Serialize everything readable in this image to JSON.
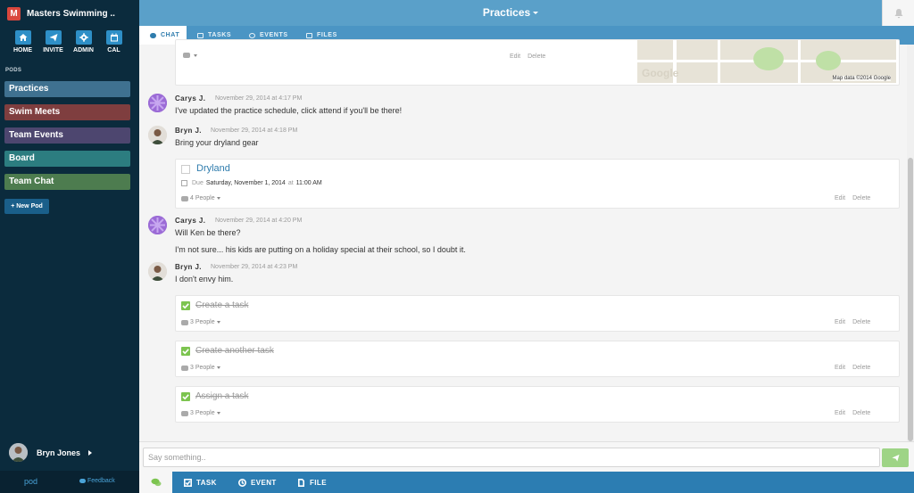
{
  "sidebar": {
    "team_initial": "M",
    "team_name": "Masters Swimming ..",
    "nav": [
      {
        "label": "HOME",
        "icon": "home-icon"
      },
      {
        "label": "INVITE",
        "icon": "paper-plane-icon"
      },
      {
        "label": "ADMIN",
        "icon": "gear-icon"
      },
      {
        "label": "CAL",
        "icon": "calendar-icon"
      }
    ],
    "pods_heading": "PODS",
    "pods": [
      {
        "label": "Practices",
        "color": "#3f7190"
      },
      {
        "label": "Swim Meets",
        "color": "#7f3e3f"
      },
      {
        "label": "Team Events",
        "color": "#4d466f"
      },
      {
        "label": "Board",
        "color": "#2c7d80"
      },
      {
        "label": "Team Chat",
        "color": "#4d7c4f"
      }
    ],
    "new_pod": "+ New Pod",
    "user_name": "Bryn Jones",
    "brand": "pod",
    "feedback": "Feedback"
  },
  "header": {
    "title": "Practices",
    "tabs": [
      "CHAT",
      "TASKS",
      "EVENTS",
      "FILES"
    ]
  },
  "map": {
    "watermark": "Google",
    "attribution": "Map data ©2014 Google"
  },
  "actions": {
    "edit": "Edit",
    "delete": "Delete"
  },
  "messages": [
    {
      "author": "Carys J.",
      "time": "November 29, 2014 at 4:17 PM",
      "text": "I've updated the practice schedule, click attend if you'll be there!"
    },
    {
      "author": "Bryn J.",
      "time": "November 29, 2014 at 4:18 PM",
      "text": "Bring your dryland gear"
    },
    {
      "author": "Carys J.",
      "time": "November 29, 2014 at 4:20 PM",
      "text": "Will Ken be there?",
      "text2": "I'm not sure... his kids are putting on a holiday special at their school, so I doubt it."
    },
    {
      "author": "Bryn J.",
      "time": "November 29, 2014 at 4:23 PM",
      "text": "I don't envy him."
    }
  ],
  "tasks": [
    {
      "title": "Dryland",
      "due_label": "Due",
      "due_value": "Saturday, November 1, 2014",
      "at": "at",
      "due_time": "11:00 AM",
      "people": "4 People"
    },
    {
      "title": "Create a task",
      "people": "3 People"
    },
    {
      "title": "Create another task",
      "people": "3 People"
    },
    {
      "title": "Assign a task",
      "people": "3 People"
    }
  ],
  "composer": {
    "placeholder": "Say something..",
    "actions": [
      "TASK",
      "EVENT",
      "FILE"
    ]
  },
  "colors": {
    "header": "#5aa0c9",
    "tabbar": "#4b95c4",
    "sidebar": "#0b2b3d",
    "actionbar": "#2c7db2",
    "accent_green": "#7cc44f"
  }
}
